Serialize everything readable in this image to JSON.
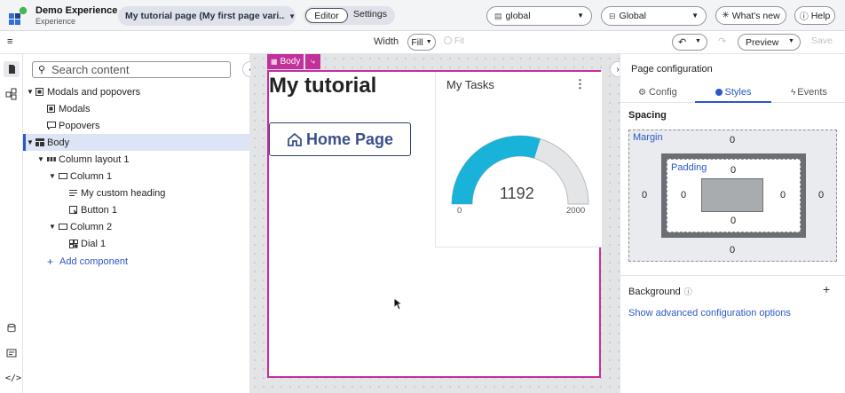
{
  "app": {
    "name": "Demo Experience",
    "subtitle": "Experience",
    "page_selector": "My tutorial page (My first page vari...",
    "mode_tabs": [
      "Editor",
      "Settings"
    ],
    "active_mode": "Editor",
    "scope_select": "global",
    "theme_select": "Global",
    "whats_new": "What's new",
    "help": "Help"
  },
  "toolbar": {
    "width_label": "Width",
    "width_value": "Fill",
    "fit_label": "Fit",
    "preview_label": "Preview",
    "save_label": "Save"
  },
  "tree": {
    "search_placeholder": "Search content",
    "items": [
      {
        "label": "Modals and popovers",
        "caret": "▼",
        "icon": "modal-icon"
      },
      {
        "label": "Modals",
        "caret": "",
        "icon": "modal-icon"
      },
      {
        "label": "Popovers",
        "caret": "",
        "icon": "popover-icon"
      },
      {
        "label": "Body",
        "caret": "▼",
        "icon": "body-icon",
        "selected": true
      },
      {
        "label": "Column layout 1",
        "caret": "▼",
        "icon": "column-layout-icon"
      },
      {
        "label": "Column 1",
        "caret": "▼",
        "icon": "column-icon"
      },
      {
        "label": "My custom heading",
        "caret": "",
        "icon": "heading-icon"
      },
      {
        "label": "Button 1",
        "caret": "",
        "icon": "button-icon"
      },
      {
        "label": "Column 2",
        "caret": "▼",
        "icon": "column-icon"
      },
      {
        "label": "Dial 1",
        "caret": "",
        "icon": "dial-icon"
      }
    ],
    "add_component": "Add component"
  },
  "canvas": {
    "body_tag": "Body",
    "heading": "My tutorial",
    "button_label": "Home Page",
    "card_title": "My Tasks",
    "dial": {
      "value": "1192",
      "min": "0",
      "max": "2000",
      "fraction": 0.596,
      "fill_color": "#19b2d8"
    }
  },
  "panel": {
    "title": "Page configuration",
    "tabs": [
      "Config",
      "Styles",
      "Events"
    ],
    "active_tab": "Styles",
    "spacing_label": "Spacing",
    "margin_label": "Margin",
    "padding_label": "Padding",
    "margin": {
      "top": "0",
      "right": "0",
      "bottom": "0",
      "left": "0"
    },
    "padding": {
      "top": "0",
      "right": "0",
      "bottom": "0",
      "left": "0"
    },
    "background_label": "Background",
    "advanced_link": "Show advanced configuration options"
  },
  "colors": {
    "accent": "#2b58c7",
    "body_outline": "#c2309b",
    "dial_track": "#e4e5e7"
  }
}
